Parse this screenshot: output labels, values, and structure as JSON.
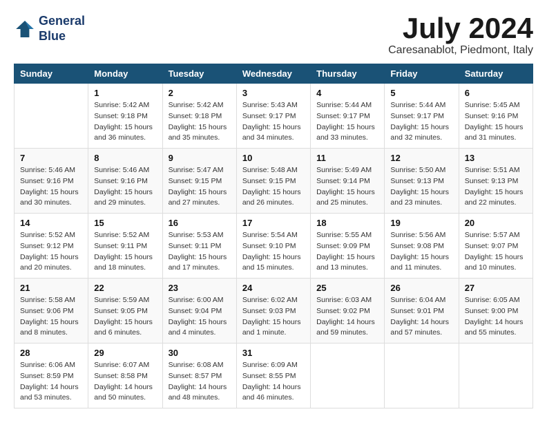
{
  "header": {
    "logo_line1": "General",
    "logo_line2": "Blue",
    "month_year": "July 2024",
    "location": "Caresanablot, Piedmont, Italy"
  },
  "weekdays": [
    "Sunday",
    "Monday",
    "Tuesday",
    "Wednesday",
    "Thursday",
    "Friday",
    "Saturday"
  ],
  "weeks": [
    [
      {
        "day": "",
        "info": ""
      },
      {
        "day": "1",
        "info": "Sunrise: 5:42 AM\nSunset: 9:18 PM\nDaylight: 15 hours\nand 36 minutes."
      },
      {
        "day": "2",
        "info": "Sunrise: 5:42 AM\nSunset: 9:18 PM\nDaylight: 15 hours\nand 35 minutes."
      },
      {
        "day": "3",
        "info": "Sunrise: 5:43 AM\nSunset: 9:17 PM\nDaylight: 15 hours\nand 34 minutes."
      },
      {
        "day": "4",
        "info": "Sunrise: 5:44 AM\nSunset: 9:17 PM\nDaylight: 15 hours\nand 33 minutes."
      },
      {
        "day": "5",
        "info": "Sunrise: 5:44 AM\nSunset: 9:17 PM\nDaylight: 15 hours\nand 32 minutes."
      },
      {
        "day": "6",
        "info": "Sunrise: 5:45 AM\nSunset: 9:16 PM\nDaylight: 15 hours\nand 31 minutes."
      }
    ],
    [
      {
        "day": "7",
        "info": "Sunrise: 5:46 AM\nSunset: 9:16 PM\nDaylight: 15 hours\nand 30 minutes."
      },
      {
        "day": "8",
        "info": "Sunrise: 5:46 AM\nSunset: 9:16 PM\nDaylight: 15 hours\nand 29 minutes."
      },
      {
        "day": "9",
        "info": "Sunrise: 5:47 AM\nSunset: 9:15 PM\nDaylight: 15 hours\nand 27 minutes."
      },
      {
        "day": "10",
        "info": "Sunrise: 5:48 AM\nSunset: 9:15 PM\nDaylight: 15 hours\nand 26 minutes."
      },
      {
        "day": "11",
        "info": "Sunrise: 5:49 AM\nSunset: 9:14 PM\nDaylight: 15 hours\nand 25 minutes."
      },
      {
        "day": "12",
        "info": "Sunrise: 5:50 AM\nSunset: 9:13 PM\nDaylight: 15 hours\nand 23 minutes."
      },
      {
        "day": "13",
        "info": "Sunrise: 5:51 AM\nSunset: 9:13 PM\nDaylight: 15 hours\nand 22 minutes."
      }
    ],
    [
      {
        "day": "14",
        "info": "Sunrise: 5:52 AM\nSunset: 9:12 PM\nDaylight: 15 hours\nand 20 minutes."
      },
      {
        "day": "15",
        "info": "Sunrise: 5:52 AM\nSunset: 9:11 PM\nDaylight: 15 hours\nand 18 minutes."
      },
      {
        "day": "16",
        "info": "Sunrise: 5:53 AM\nSunset: 9:11 PM\nDaylight: 15 hours\nand 17 minutes."
      },
      {
        "day": "17",
        "info": "Sunrise: 5:54 AM\nSunset: 9:10 PM\nDaylight: 15 hours\nand 15 minutes."
      },
      {
        "day": "18",
        "info": "Sunrise: 5:55 AM\nSunset: 9:09 PM\nDaylight: 15 hours\nand 13 minutes."
      },
      {
        "day": "19",
        "info": "Sunrise: 5:56 AM\nSunset: 9:08 PM\nDaylight: 15 hours\nand 11 minutes."
      },
      {
        "day": "20",
        "info": "Sunrise: 5:57 AM\nSunset: 9:07 PM\nDaylight: 15 hours\nand 10 minutes."
      }
    ],
    [
      {
        "day": "21",
        "info": "Sunrise: 5:58 AM\nSunset: 9:06 PM\nDaylight: 15 hours\nand 8 minutes."
      },
      {
        "day": "22",
        "info": "Sunrise: 5:59 AM\nSunset: 9:05 PM\nDaylight: 15 hours\nand 6 minutes."
      },
      {
        "day": "23",
        "info": "Sunrise: 6:00 AM\nSunset: 9:04 PM\nDaylight: 15 hours\nand 4 minutes."
      },
      {
        "day": "24",
        "info": "Sunrise: 6:02 AM\nSunset: 9:03 PM\nDaylight: 15 hours\nand 1 minute."
      },
      {
        "day": "25",
        "info": "Sunrise: 6:03 AM\nSunset: 9:02 PM\nDaylight: 14 hours\nand 59 minutes."
      },
      {
        "day": "26",
        "info": "Sunrise: 6:04 AM\nSunset: 9:01 PM\nDaylight: 14 hours\nand 57 minutes."
      },
      {
        "day": "27",
        "info": "Sunrise: 6:05 AM\nSunset: 9:00 PM\nDaylight: 14 hours\nand 55 minutes."
      }
    ],
    [
      {
        "day": "28",
        "info": "Sunrise: 6:06 AM\nSunset: 8:59 PM\nDaylight: 14 hours\nand 53 minutes."
      },
      {
        "day": "29",
        "info": "Sunrise: 6:07 AM\nSunset: 8:58 PM\nDaylight: 14 hours\nand 50 minutes."
      },
      {
        "day": "30",
        "info": "Sunrise: 6:08 AM\nSunset: 8:57 PM\nDaylight: 14 hours\nand 48 minutes."
      },
      {
        "day": "31",
        "info": "Sunrise: 6:09 AM\nSunset: 8:55 PM\nDaylight: 14 hours\nand 46 minutes."
      },
      {
        "day": "",
        "info": ""
      },
      {
        "day": "",
        "info": ""
      },
      {
        "day": "",
        "info": ""
      }
    ]
  ]
}
